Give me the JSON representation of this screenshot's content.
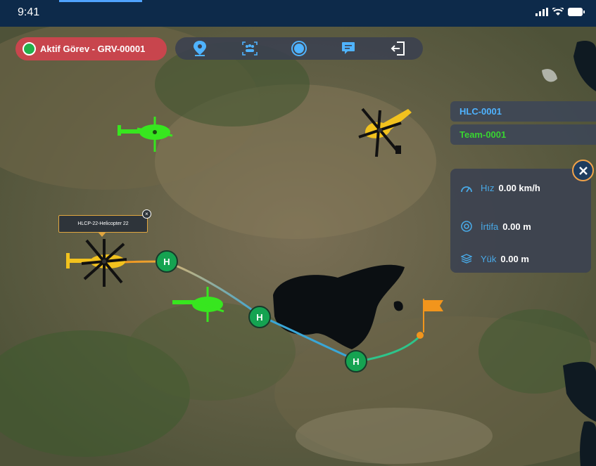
{
  "status_bar": {
    "time": "9:41"
  },
  "mission": {
    "label": "Aktif Görev - GRV-00001",
    "color": "#c8454d"
  },
  "toolbar": {
    "tools": [
      {
        "name": "location-pin-icon"
      },
      {
        "name": "team-scan-icon"
      },
      {
        "name": "record-icon"
      },
      {
        "name": "chat-icon"
      },
      {
        "name": "exit-icon"
      }
    ]
  },
  "side_tags": {
    "helicopter": {
      "label": "HLC-0001",
      "color": "#4fb3ff"
    },
    "team": {
      "label": "Team-0001",
      "color": "#39d431"
    }
  },
  "info": {
    "speed": {
      "label": "Hız",
      "value": "0.00 km/h"
    },
    "altitude": {
      "label": "İrtifa",
      "value": "0.00 m"
    },
    "load": {
      "label": "Yük",
      "value": "0.00 m"
    }
  },
  "selected_helicopter": {
    "label": "HLCP-22-Helicopter 22",
    "close": "×"
  },
  "waypoints": [
    {
      "label": "H"
    },
    {
      "label": "H"
    },
    {
      "label": "H"
    }
  ],
  "colors": {
    "helicopter_yellow": "#f2c21e",
    "helicopter_green": "#37e61f",
    "route_blue": "#3aa6d6",
    "route_green": "#2ec48b",
    "flag_orange": "#f2951c"
  }
}
